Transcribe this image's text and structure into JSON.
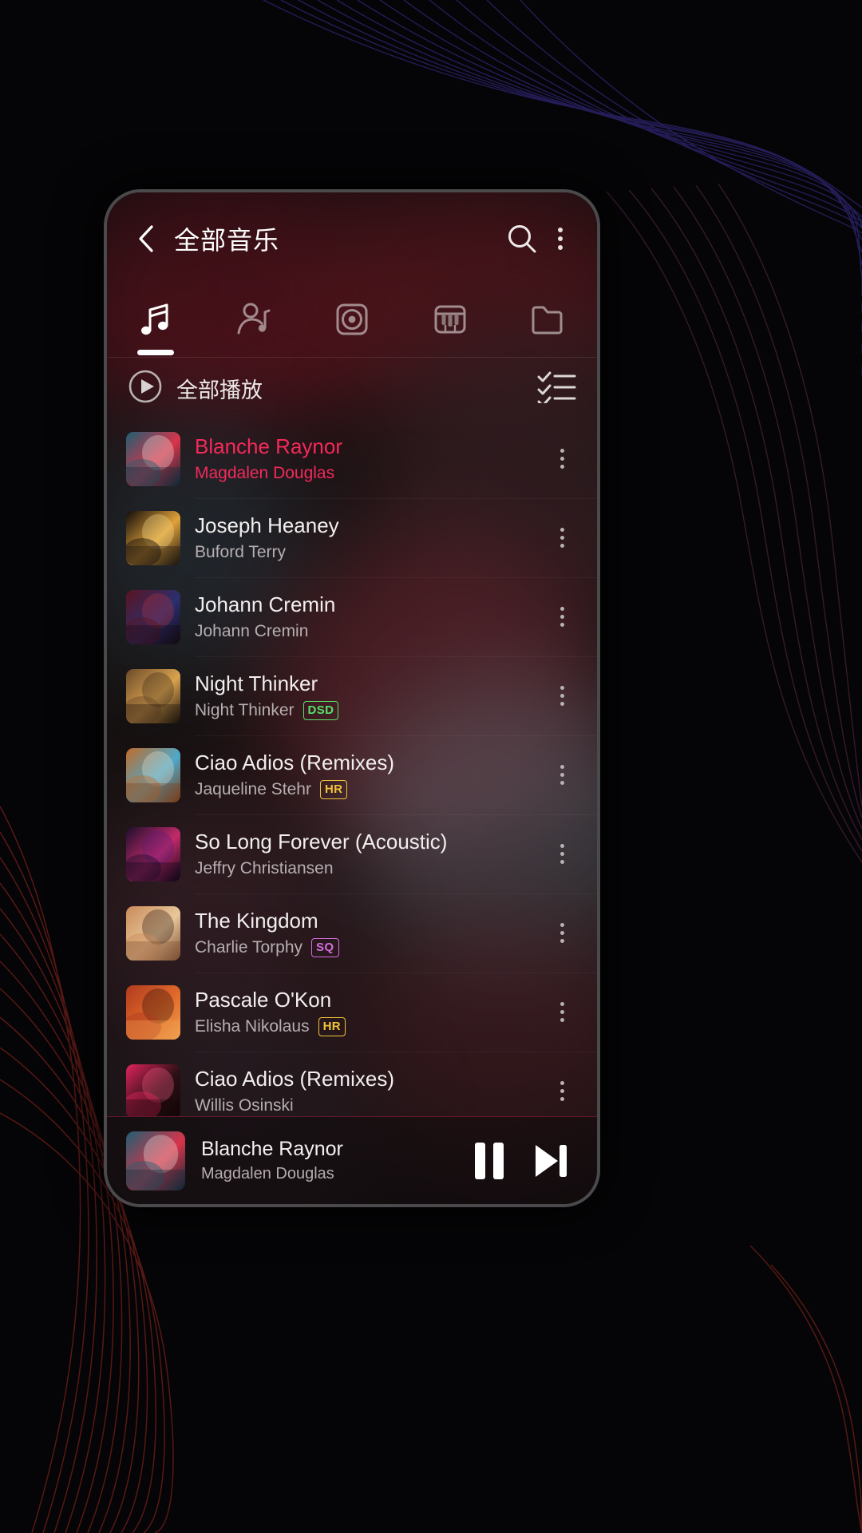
{
  "header": {
    "title": "全部音乐",
    "back_icon": "chevron-left-icon",
    "search_icon": "search-icon",
    "more_icon": "overflow-menu-icon"
  },
  "tabs": [
    {
      "key": "songs",
      "icon": "music-note-icon",
      "active": true
    },
    {
      "key": "artists",
      "icon": "artist-icon",
      "active": false
    },
    {
      "key": "albums",
      "icon": "album-disc-icon",
      "active": false
    },
    {
      "key": "genres",
      "icon": "piano-keys-icon",
      "active": false
    },
    {
      "key": "folders",
      "icon": "folder-icon",
      "active": false
    }
  ],
  "play_all": {
    "label": "全部播放",
    "play_icon": "play-circle-icon",
    "multiselect_icon": "checklist-icon"
  },
  "colors": {
    "accent_pink": "#f5295a",
    "badge_dsd": "#58e06a",
    "badge_hr": "#f0c33c",
    "badge_sq": "#d86be0",
    "text_primary": "#f2eeee",
    "text_secondary": "#b6aeb0"
  },
  "songs": [
    {
      "title": "Blanche Raynor",
      "artist": "Magdalen Douglas",
      "badge": "",
      "playing": true,
      "art": "a1"
    },
    {
      "title": "Joseph Heaney",
      "artist": "Buford Terry",
      "badge": "",
      "playing": false,
      "art": "a2"
    },
    {
      "title": "Johann Cremin",
      "artist": "Johann Cremin",
      "badge": "",
      "playing": false,
      "art": "a3"
    },
    {
      "title": "Night Thinker",
      "artist": "Night Thinker",
      "badge": "DSD",
      "playing": false,
      "art": "a4"
    },
    {
      "title": "Ciao Adios (Remixes)",
      "artist": "Jaqueline Stehr",
      "badge": "HR",
      "playing": false,
      "art": "a5"
    },
    {
      "title": "So Long Forever (Acoustic)",
      "artist": "Jeffry Christiansen",
      "badge": "",
      "playing": false,
      "art": "a6"
    },
    {
      "title": "The Kingdom",
      "artist": "Charlie Torphy",
      "badge": "SQ",
      "playing": false,
      "art": "a7"
    },
    {
      "title": "Pascale O'Kon",
      "artist": "Elisha Nikolaus",
      "badge": "HR",
      "playing": false,
      "art": "a8"
    },
    {
      "title": "Ciao Adios (Remixes)",
      "artist": "Willis Osinski",
      "badge": "",
      "playing": false,
      "art": "a9"
    }
  ],
  "mini_player": {
    "title": "Blanche Raynor",
    "artist": "Magdalen Douglas",
    "pause_icon": "pause-icon",
    "next_icon": "skip-next-icon",
    "art": "a1"
  }
}
